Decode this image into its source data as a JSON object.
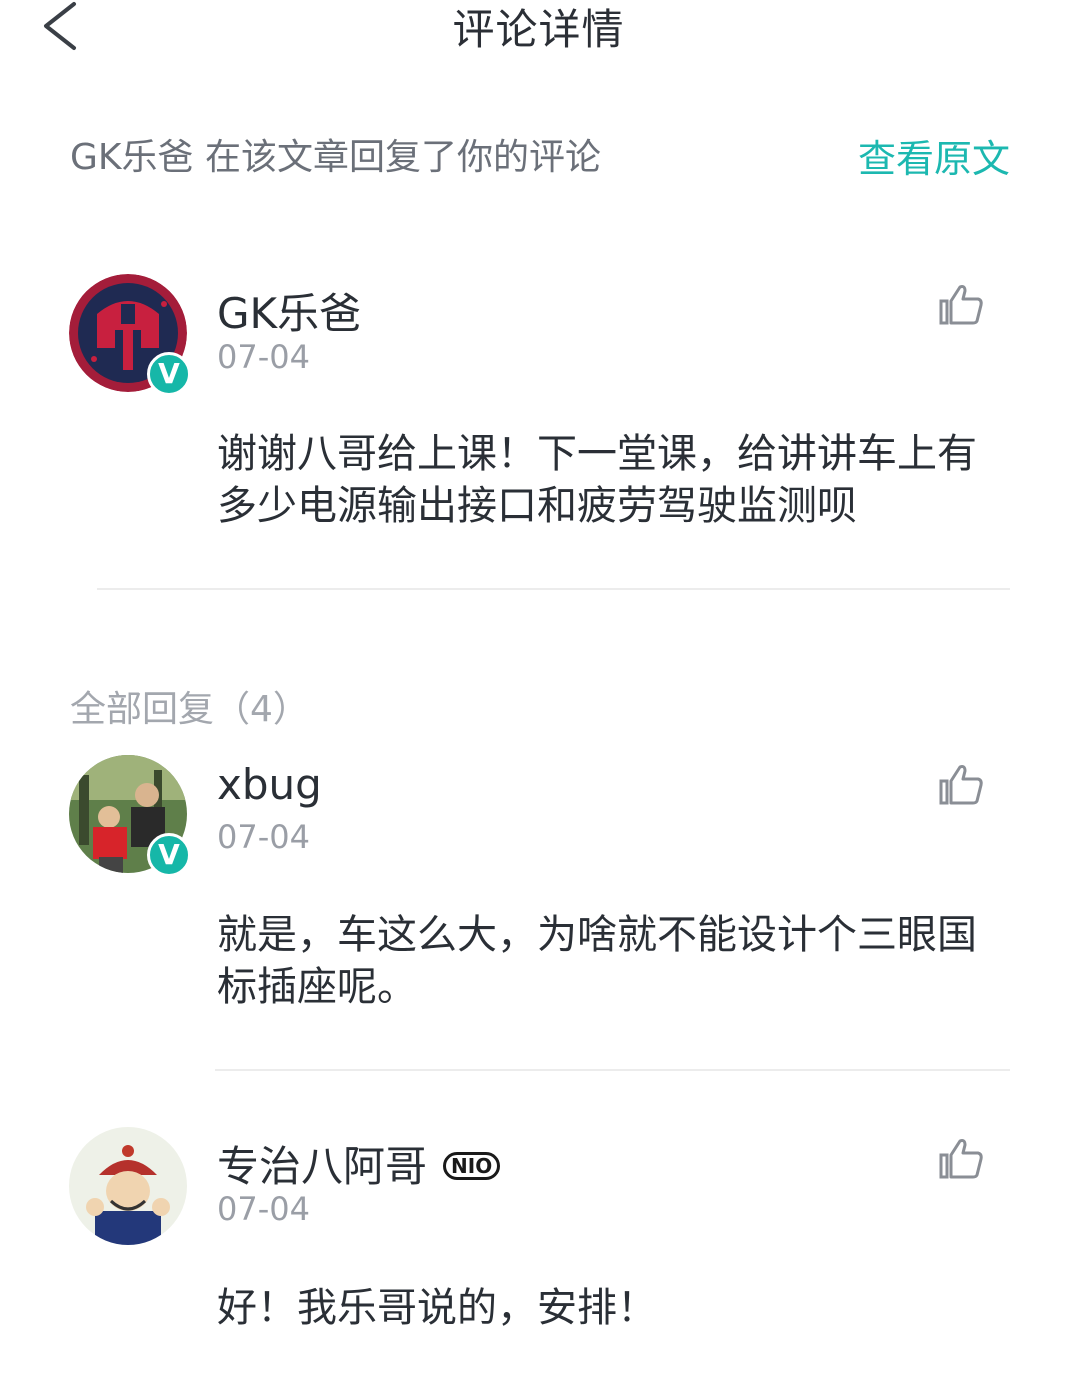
{
  "header": {
    "title": "评论详情",
    "back_icon": "chevron-left-icon"
  },
  "notice": {
    "text": "GK乐爸 在该文章回复了你的评论",
    "link_label": "查看原文",
    "link_color": "#1cb8b0"
  },
  "main_comment": {
    "author": "GK乐爸",
    "date": "07-04",
    "text": "谢谢八哥给上课！下一堂课，给讲讲车上有多少电源输出接口和疲劳驾驶监测呗",
    "verified_badge": "V",
    "like_icon": "thumbs-up-icon"
  },
  "replies_section": {
    "title": "全部回复（4）"
  },
  "replies": [
    {
      "author": "xbug",
      "date": "07-04",
      "text": "就是，车这么大，为啥就不能设计个三眼国标插座呢。",
      "verified_badge": "V"
    },
    {
      "author": "专治八阿哥",
      "badge": "NIO",
      "date": "07-04",
      "text": "好！我乐哥说的，安排！"
    }
  ]
}
